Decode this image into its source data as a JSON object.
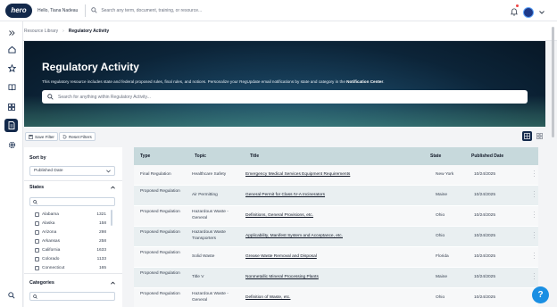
{
  "header": {
    "logo_text": "hero",
    "greeting": "Hello, Tiana Nadeau",
    "search_placeholder": "Search any term, document, training, or resource..."
  },
  "breadcrumb": {
    "parent": "Resource Library",
    "current": "Regulatory Activity"
  },
  "hero": {
    "title": "Regulatory Activity",
    "subtitle_pre": "This regulatory resource includes state and federal proposed rules, final rules, and notices. Personalize your RegUpdate email notifications by state and category in the ",
    "subtitle_link": "Notification Center",
    "subtitle_post": ".",
    "search_placeholder": "Search for anything within Regulatory Activity..."
  },
  "toolbar": {
    "save_filter": "Save Filter",
    "reset_filters": "Reset Filters"
  },
  "filters": {
    "sort_label": "Sort by",
    "sort_value": "Published Date",
    "states_label": "States",
    "states": [
      {
        "name": "Alabama",
        "count": "1321"
      },
      {
        "name": "Alaska",
        "count": "158"
      },
      {
        "name": "Arizona",
        "count": "298"
      },
      {
        "name": "Arkansas",
        "count": "258"
      },
      {
        "name": "California",
        "count": "1633"
      },
      {
        "name": "Colorado",
        "count": "1133"
      },
      {
        "name": "Connecticut",
        "count": "165"
      }
    ],
    "categories_label": "Categories"
  },
  "table": {
    "headers": [
      "Type",
      "Topic",
      "Title",
      "State",
      "Published Date"
    ],
    "rows": [
      {
        "type": "Final Regulation",
        "topic": "Healthcare Safety",
        "title": "Emergency Medical Services Equipment Requirements",
        "state": "New York",
        "date": "10/24/2025"
      },
      {
        "type": "Proposed Regulation",
        "topic": "Air Permitting",
        "title": "General Permit for Class IV-A Incinerators",
        "state": "Maine",
        "date": "10/24/2025"
      },
      {
        "type": "Proposed Regulation",
        "topic": "Hazardous Waste - General",
        "title": "Definitions, General Provisions, etc.",
        "state": "Ohio",
        "date": "10/24/2025"
      },
      {
        "type": "Proposed Regulation",
        "topic": "Hazardous Waste Transporters",
        "title": "Applicability, Manifest System and Acceptance, etc.",
        "state": "Ohio",
        "date": "10/24/2025"
      },
      {
        "type": "Proposed Regulation",
        "topic": "Solid Waste",
        "title": "Grease Waste Removal and Disposal",
        "state": "Florida",
        "date": "10/24/2025"
      },
      {
        "type": "Proposed Regulation",
        "topic": "Title V",
        "title": "Nonmetallic Mineral Processing Plants",
        "state": "Maine",
        "date": "10/24/2025"
      },
      {
        "type": "Proposed Regulation",
        "topic": "Hazardous Waste - General",
        "title": "Definition of Waste, etc.",
        "state": "Ohio",
        "date": "10/24/2025"
      }
    ]
  },
  "help": "?"
}
